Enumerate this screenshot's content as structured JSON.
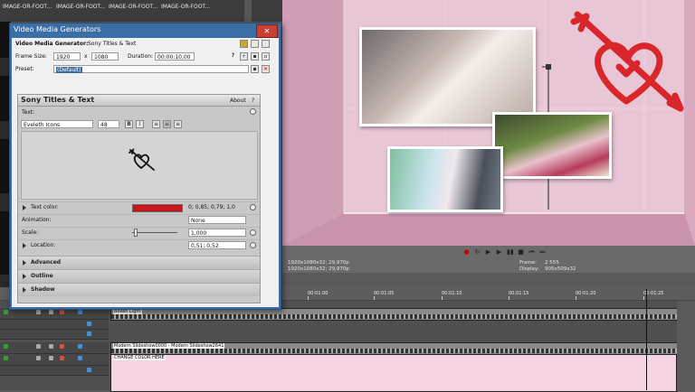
{
  "media_bin": {
    "labels": [
      "IMAGE-OR-FOOT...",
      "IMAGE-OR-FOOT...",
      "IMAGE-OR-FOOT...",
      "IMAGE-OR-FOOT..."
    ],
    "row2_labels": [
      "IMAGE-OR-FOOT...",
      "IMAGE-OR-FOOT...",
      "IMAGE-OR-FOOT...",
      "IMAGE-OR-FOOT..."
    ]
  },
  "dialog": {
    "title": "Video Media Generators",
    "close_glyph": "✕",
    "generator_label": "Video Media Generator:",
    "generator_name": "Sony Titles & Text",
    "frame_size_label": "Frame Size:",
    "frame_w": "1920",
    "frame_x": "x",
    "frame_h": "1080",
    "duration_label": "Duration:",
    "duration_value": "00:00:10,00",
    "preset_label": "Preset:",
    "preset_value": "(Default)",
    "panel_title": "Sony Titles & Text",
    "about": "About",
    "help": "?",
    "text_label": "Text:",
    "font_name": "Eveleth Icons",
    "font_size": "48",
    "bold": "B",
    "italic": "I",
    "text_color_label": "Text color:",
    "text_color_value": "0; 0,85; 0,79; 1,0",
    "text_color_swatch": "#c8161d",
    "animation_label": "Animation:",
    "animation_value": "None",
    "scale_label": "Scale:",
    "scale_value": "1,000",
    "location_label": "Location:",
    "location_value": "0,51; 0,52",
    "sections": [
      "Advanced",
      "Outline",
      "Shadow"
    ]
  },
  "preview": {
    "background_color": "#e6bfd0",
    "heart_color": "#d9262a"
  },
  "info": {
    "project_line1": "1920x1080x32; 29,970p",
    "project_line2": "1920x1080x32; 29,970p",
    "frame_label": "Frame:",
    "frame_value": "2 555",
    "display_label": "Display:",
    "display_value": "905x509x32"
  },
  "timeline": {
    "ruler": [
      "00:01:00",
      "00:01:05",
      "00:01:10",
      "00:01:15",
      "00:01:20",
      "00:01:25"
    ],
    "clips": {
      "track1": "Bokeh Light",
      "track2": "Modern Slideshow0000 - Modern Slideshow2641",
      "track3": "CHANGE COLOR HERE"
    }
  }
}
